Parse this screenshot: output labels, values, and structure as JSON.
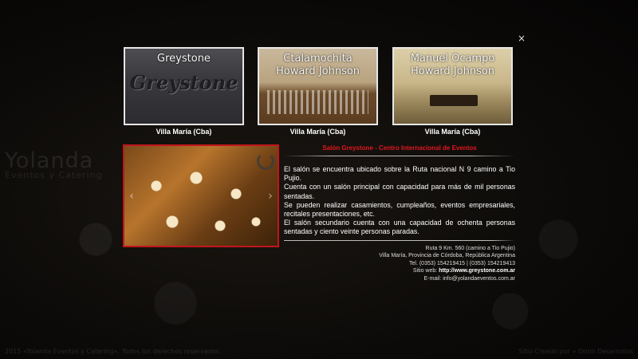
{
  "background": {
    "logo_main": "Yolanda",
    "logo_sub": "Eventos y Catering",
    "footer_left": "2015 «Yolanda Eventos y Catering». Todos los derechos reservados",
    "footer_right": "Sitio Creado por » Orion Desarrollos"
  },
  "close": {
    "label": "×"
  },
  "thumbnails": [
    {
      "title_line1": "Greystone",
      "title_line2": "",
      "sign_text": "Greystone",
      "caption": "Villa María (Cba)"
    },
    {
      "title_line1": "Ctalamochita",
      "title_line2": "Howard Johnson",
      "caption": "Villa María (Cba)"
    },
    {
      "title_line1": "Manuel Ocampo",
      "title_line2": "Howard Johnson",
      "caption": "Villa María (Cba)"
    }
  ],
  "detail": {
    "title": "Salón Greystone - Centro Internacional de Eventos",
    "paragraphs": [
      "El salón se encuentra ubicado sobre la Ruta nacional N 9 camino a Tio Pujio.",
      "Cuenta con un salón principal con capacidad para más de mil personas sentadas.",
      "Se pueden realizar casamientos, cumpleaños, eventos empresariales, recitales presentaciones, etc.",
      "El salón secundario cuenta con una capacidad de ochenta personas sentadas y ciento veinte personas paradas."
    ],
    "address_line1": "Ruta 9 Km. 560 (camino a Tio Pujio)",
    "address_line2": "Villa María, Provincia de Córdoba, República Argentina",
    "phone": "Tel. (0353) 154219415 | (0353) 154219413",
    "web_label": "Sitio web:",
    "web": "http://www.greystone.com.ar",
    "email_label": "E-mail:",
    "email": "info@yolandaeventos.com.ar"
  },
  "icons": {
    "close": "close-icon",
    "prev": "chevron-left-icon",
    "next": "chevron-right-icon",
    "loading": "spinner-icon"
  },
  "colors": {
    "accent": "#e3161d",
    "photo_border": "#c0161c",
    "thumb_border": "#e6e6e6",
    "background": "#0b0a08"
  }
}
